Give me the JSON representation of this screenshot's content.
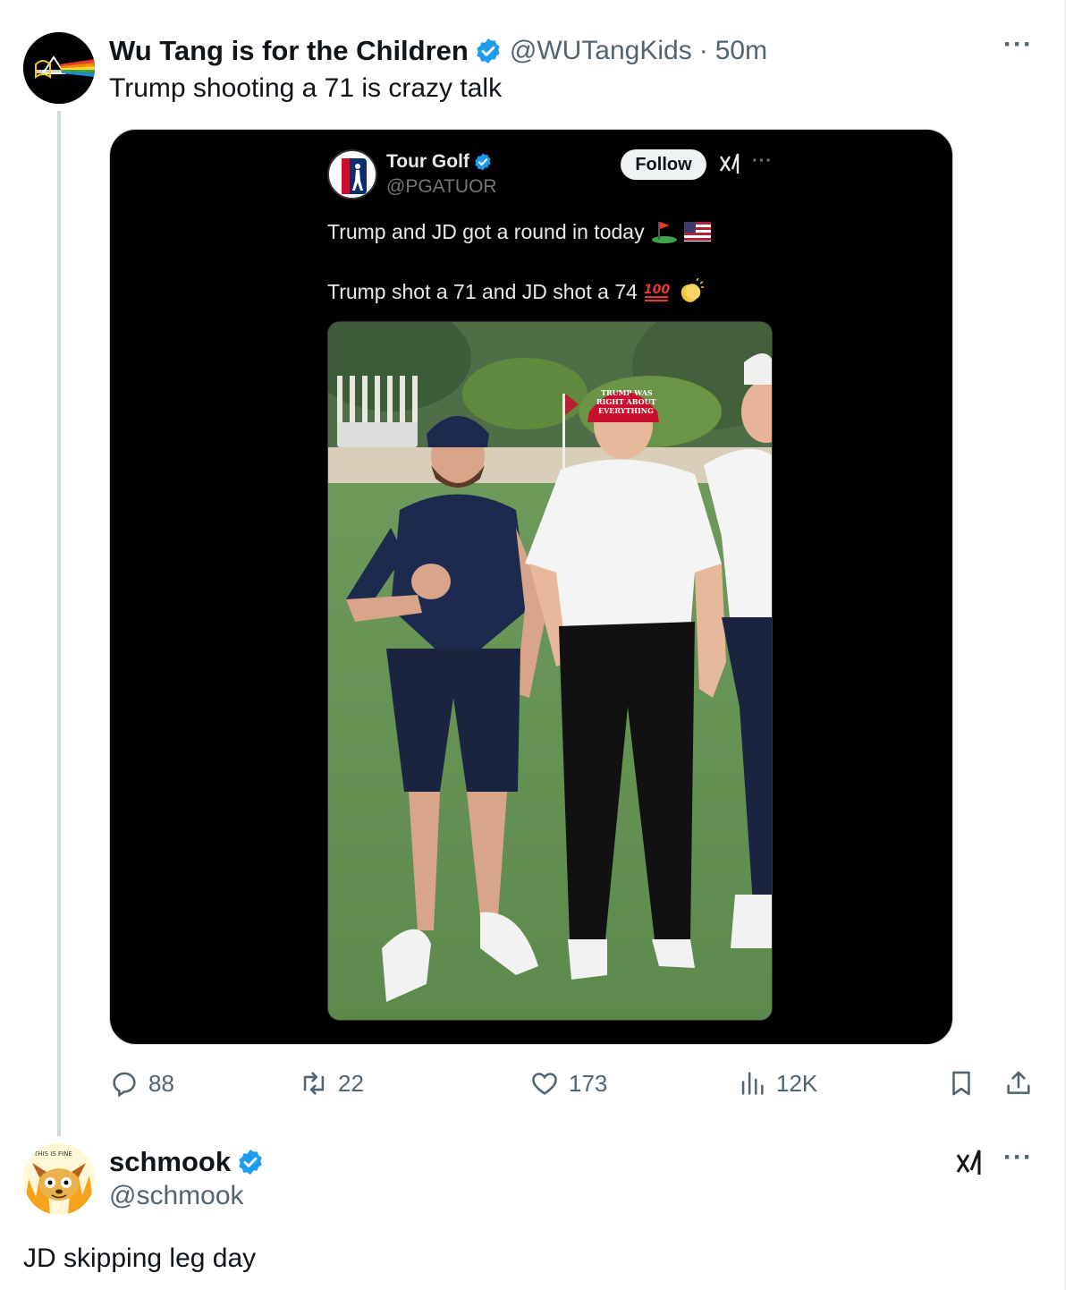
{
  "tweet": {
    "display_name": "Wu Tang is for the Children",
    "handle": "@WUTangKids",
    "separator": "·",
    "time": "50m",
    "text": "Trump shooting a 71 is crazy talk",
    "more_label": "···"
  },
  "embedded_screenshot": {
    "display_name": "Tour Golf",
    "handle": "@PGATUOR",
    "follow_label": "Follow",
    "more_label": "···",
    "line1": "Trump and JD got a round in today",
    "line1_emojis": [
      "golf-flag-emoji",
      "us-flag-emoji"
    ],
    "line2": "Trump shot a 71 and JD shot a 74",
    "line2_emojis": [
      "hundred-points-emoji",
      "clapping-hands-emoji"
    ],
    "logo_text": "PGA TOUR",
    "hat_text": "TRUMP WAS RIGHT ABOUT EVERYTHING"
  },
  "actions": {
    "replies": "88",
    "reposts": "22",
    "likes": "173",
    "views": "12K"
  },
  "reply": {
    "display_name": "schmook",
    "handle": "@schmook",
    "text": "JD skipping leg day",
    "more_label": "···",
    "avatar_caption": "THIS IS FINE"
  },
  "colors": {
    "verified_blue": "#1d9bf0",
    "secondary_text": "#536471",
    "primary_text": "#0f1419",
    "media_background": "#000000",
    "hat_red": "#c8102e"
  }
}
